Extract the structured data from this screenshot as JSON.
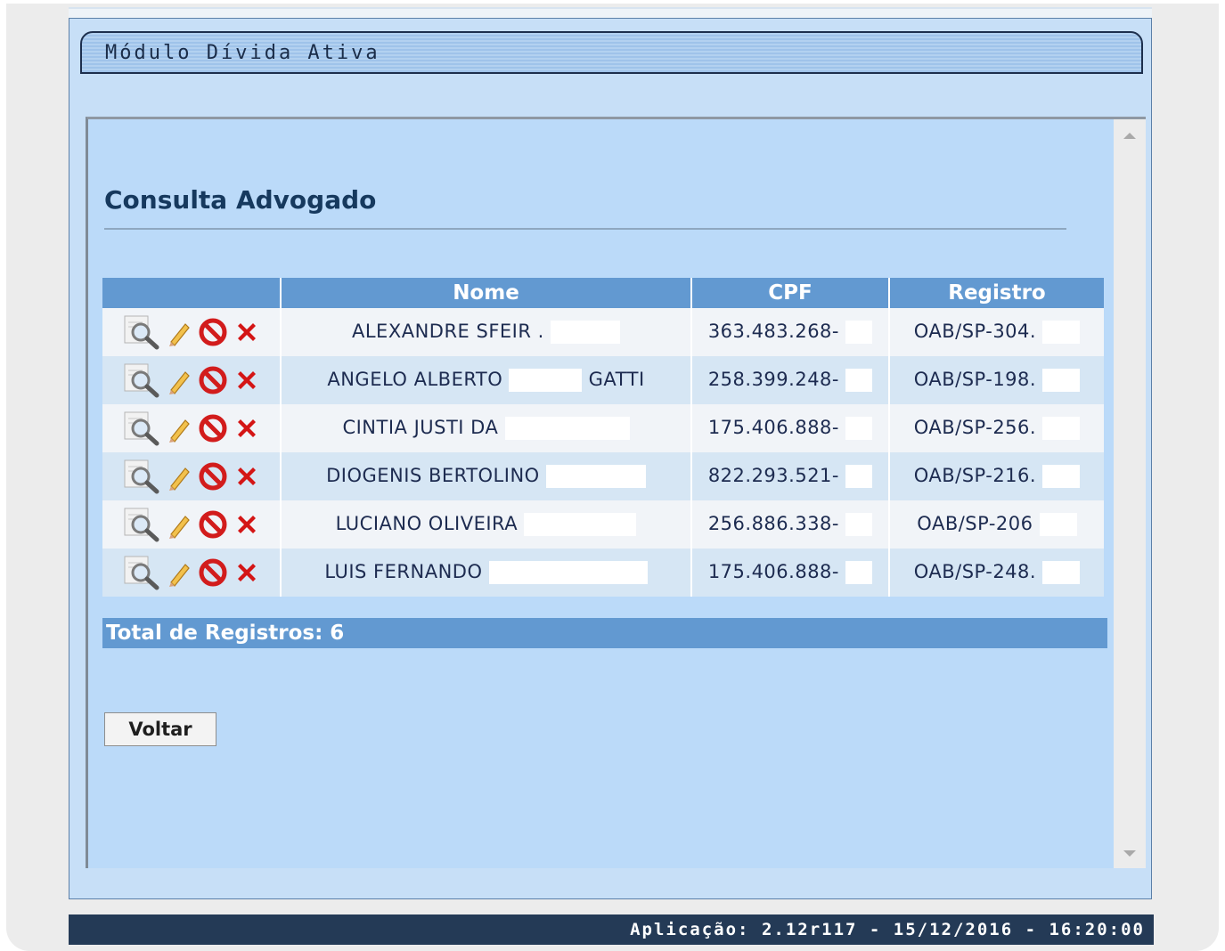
{
  "module": {
    "title": "Módulo Dívida Ativa"
  },
  "page": {
    "title": "Consulta Advogado"
  },
  "table": {
    "headers": [
      "",
      "Nome",
      "CPF",
      "Registro"
    ],
    "rows": [
      {
        "nome": "ALEXANDRE SFEIR .",
        "nome_suffix": "",
        "cpf": "363.483.268-",
        "registro": "OAB/SP-304."
      },
      {
        "nome": "ANGELO ALBERTO",
        "nome_suffix": "GATTI",
        "cpf": "258.399.248-",
        "registro": "OAB/SP-198."
      },
      {
        "nome": "CINTIA JUSTI DA",
        "nome_suffix": "",
        "cpf": "175.406.888-",
        "registro": "OAB/SP-256."
      },
      {
        "nome": "DIOGENIS BERTOLINO",
        "nome_suffix": "",
        "cpf": "822.293.521-",
        "registro": "OAB/SP-216."
      },
      {
        "nome": "LUCIANO OLIVEIRA",
        "nome_suffix": "",
        "cpf": "256.886.338-",
        "registro": "OAB/SP-206"
      },
      {
        "nome": "LUIS FERNANDO",
        "nome_suffix": "",
        "cpf": "175.406.888-",
        "registro": "OAB/SP-248."
      }
    ],
    "actions": [
      "view-icon",
      "edit-pencil-icon",
      "block-icon",
      "delete-x-icon"
    ],
    "total_label": "Total de Registros: 6"
  },
  "buttons": {
    "back": "Voltar"
  },
  "status": {
    "text": "Aplicação: 2.12r117 - 15/12/2016 - 16:20:00"
  },
  "colors": {
    "header_blue": "#6299d1",
    "panel_blue": "#bbdaf9",
    "status_bar": "#243a56"
  }
}
